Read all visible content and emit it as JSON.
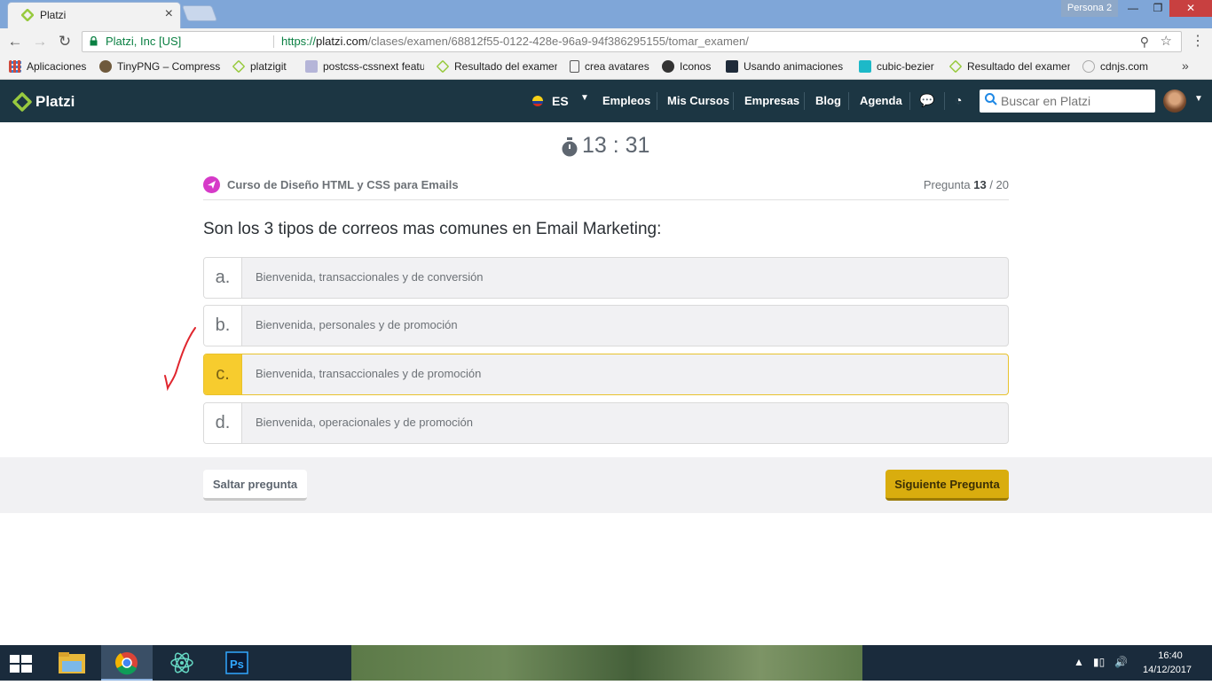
{
  "browser": {
    "tab_title": "Platzi",
    "tab_close": "×",
    "profile": "Persona 2",
    "secure_label": "Platzi, Inc [US]",
    "url_scheme": "https://",
    "url_host": "platzi.com",
    "url_path": "/clases/examen/68812f55-0122-428e-96a9-94f386295155/tomar_examen/"
  },
  "bookmarks": [
    {
      "label": "Aplicaciones",
      "color": "#d04a3c"
    },
    {
      "label": "TinyPNG – Compress",
      "color": "#6f5a3c"
    },
    {
      "label": "platzigit",
      "color": "#98ca3f"
    },
    {
      "label": "postcss-cssnext featu",
      "color": "#b5b5d8"
    },
    {
      "label": "Resultado del examen",
      "color": "#98ca3f"
    },
    {
      "label": "crea avatares",
      "color": "#ffffff"
    },
    {
      "label": "Iconos",
      "color": "#333333"
    },
    {
      "label": "Usando animaciones",
      "color": "#1f2b3a"
    },
    {
      "label": "cubic-bezier",
      "color": "#1db9c8"
    },
    {
      "label": "Resultado del examen",
      "color": "#98ca3f"
    },
    {
      "label": "cdnjs.com",
      "color": "#ffffff"
    }
  ],
  "navbar": {
    "logo": "Platzi",
    "lang": "ES",
    "links": [
      "Empleos",
      "Mis Cursos",
      "Empresas",
      "Blog",
      "Agenda"
    ],
    "search_placeholder": "Buscar en Platzi"
  },
  "exam": {
    "timer": "13 : 31",
    "course": "Curso de Diseño HTML y CSS para Emails",
    "question_label": "Pregunta",
    "question_current": "13",
    "question_total": "/ 20",
    "question": "Son los 3 tipos de correos mas comunes en Email Marketing:",
    "options": [
      {
        "letter": "a.",
        "text": "Bienvenida, transaccionales y de conversión",
        "selected": false
      },
      {
        "letter": "b.",
        "text": "Bienvenida, personales y de promoción",
        "selected": false
      },
      {
        "letter": "c.",
        "text": "Bienvenida, transaccionales y de promoción",
        "selected": true
      },
      {
        "letter": "d.",
        "text": "Bienvenida, operacionales y de promoción",
        "selected": false
      }
    ],
    "skip_label": "Saltar pregunta",
    "next_label": "Siguiente Pregunta",
    "accent_color": "#f7cc2e"
  },
  "taskbar": {
    "apps": [
      "file-explorer-icon",
      "chrome-icon",
      "atom-icon",
      "photoshop-icon"
    ],
    "photoshop_label": "Ps",
    "time": "16:40",
    "date": "14/12/2017"
  }
}
